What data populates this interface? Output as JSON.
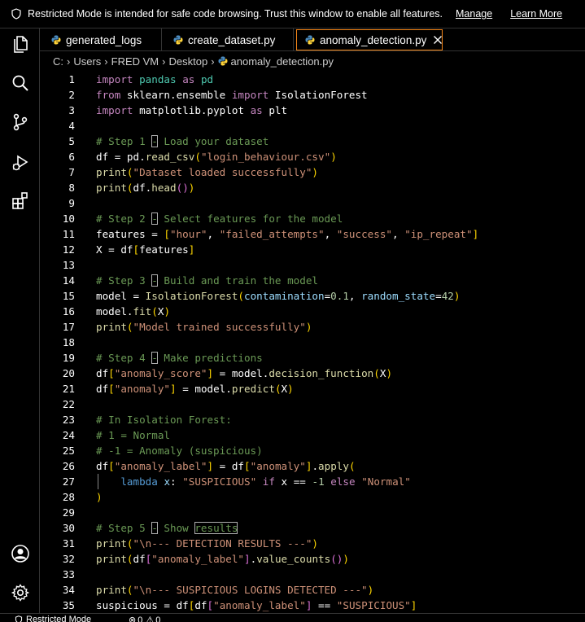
{
  "banner": {
    "message": "Restricted Mode is intended for safe code browsing. Trust this window to enable all features.",
    "manage": "Manage",
    "learn_more": "Learn More"
  },
  "activity_bar": {
    "items": [
      "explorer-icon",
      "search-icon",
      "source-control-icon",
      "run-debug-icon",
      "extensions-icon",
      "accounts-icon",
      "settings-gear-icon"
    ]
  },
  "tabs": [
    {
      "label": "generated_logs"
    },
    {
      "label": "create_dataset.py"
    },
    {
      "label": "anomaly_detection.py",
      "active": true
    }
  ],
  "breadcrumb": [
    "C:",
    "Users",
    "FRED VM",
    "Desktop",
    "anomaly_detection.py"
  ],
  "editor": {
    "lines": [
      {
        "n": "1",
        "tokens": [
          [
            "import",
            "kw"
          ],
          [
            " ",
            ""
          ],
          [
            "pandas",
            "cls"
          ],
          [
            " ",
            ""
          ],
          [
            "as",
            "kw"
          ],
          [
            " ",
            ""
          ],
          [
            "pd",
            "cls"
          ]
        ]
      },
      {
        "n": "2",
        "tokens": [
          [
            "from",
            "kw"
          ],
          [
            " sklearn.ensemble ",
            ""
          ],
          [
            "import",
            "kw"
          ],
          [
            " IsolationForest",
            ""
          ]
        ]
      },
      {
        "n": "3",
        "tokens": [
          [
            "import",
            "kw"
          ],
          [
            " matplotlib.pyplot ",
            ""
          ],
          [
            "as",
            "kw"
          ],
          [
            " plt",
            ""
          ]
        ]
      },
      {
        "n": "4",
        "tokens": []
      },
      {
        "n": "5",
        "tokens": [
          [
            "# Step 1 ",
            "cm"
          ],
          [
            "-",
            "cm hl"
          ],
          [
            " Load your dataset",
            "cm"
          ]
        ]
      },
      {
        "n": "6",
        "tokens": [
          [
            "df",
            ""
          ],
          [
            " = ",
            ""
          ],
          [
            "pd",
            ""
          ],
          [
            ".",
            ""
          ],
          [
            "read_csv",
            "fn"
          ],
          [
            "(",
            "pr1"
          ],
          [
            "\"login_behaviour.csv\"",
            "str"
          ],
          [
            ")",
            "pr1"
          ]
        ]
      },
      {
        "n": "7",
        "tokens": [
          [
            "print",
            "fn"
          ],
          [
            "(",
            "pr1"
          ],
          [
            "\"Dataset loaded successfully\"",
            "str"
          ],
          [
            ")",
            "pr1"
          ]
        ]
      },
      {
        "n": "8",
        "tokens": [
          [
            "print",
            "fn"
          ],
          [
            "(",
            "pr1"
          ],
          [
            "df.",
            ""
          ],
          [
            "head",
            "fn"
          ],
          [
            "()",
            "pr2"
          ],
          [
            ")",
            "pr1"
          ]
        ]
      },
      {
        "n": "9",
        "tokens": []
      },
      {
        "n": "10",
        "tokens": [
          [
            "# Step 2 ",
            "cm"
          ],
          [
            "-",
            "cm hl"
          ],
          [
            " Select features for the model",
            "cm"
          ]
        ]
      },
      {
        "n": "11",
        "tokens": [
          [
            "features",
            ""
          ],
          [
            " = ",
            ""
          ],
          [
            "[",
            "pr1"
          ],
          [
            "\"hour\"",
            "str"
          ],
          [
            ", ",
            ""
          ],
          [
            "\"failed_attempts\"",
            "str"
          ],
          [
            ", ",
            ""
          ],
          [
            "\"success\"",
            "str"
          ],
          [
            ", ",
            ""
          ],
          [
            "\"ip_repeat\"",
            "str"
          ],
          [
            "]",
            "pr1"
          ]
        ]
      },
      {
        "n": "12",
        "tokens": [
          [
            "X",
            ""
          ],
          [
            " = df",
            ""
          ],
          [
            "[",
            "pr1"
          ],
          [
            "features",
            ""
          ],
          [
            "]",
            "pr1"
          ]
        ]
      },
      {
        "n": "13",
        "tokens": []
      },
      {
        "n": "14",
        "tokens": [
          [
            "# Step 3 ",
            "cm"
          ],
          [
            "-",
            "cm hl"
          ],
          [
            " Build and train the model",
            "cm"
          ]
        ]
      },
      {
        "n": "15",
        "tokens": [
          [
            "model",
            ""
          ],
          [
            " = ",
            ""
          ],
          [
            "IsolationForest",
            "fn"
          ],
          [
            "(",
            "pr1"
          ],
          [
            "contamination",
            "var"
          ],
          [
            "=",
            ""
          ],
          [
            "0.1",
            "num"
          ],
          [
            ", ",
            ""
          ],
          [
            "random_state",
            "var"
          ],
          [
            "=",
            ""
          ],
          [
            "42",
            "num"
          ],
          [
            ")",
            "pr1"
          ]
        ]
      },
      {
        "n": "16",
        "tokens": [
          [
            "model.",
            ""
          ],
          [
            "fit",
            "fn"
          ],
          [
            "(",
            "pr1"
          ],
          [
            "X",
            ""
          ],
          [
            ")",
            "pr1"
          ]
        ]
      },
      {
        "n": "17",
        "tokens": [
          [
            "print",
            "fn"
          ],
          [
            "(",
            "pr1"
          ],
          [
            "\"Model trained successfully\"",
            "str"
          ],
          [
            ")",
            "pr1"
          ]
        ]
      },
      {
        "n": "18",
        "tokens": []
      },
      {
        "n": "19",
        "tokens": [
          [
            "# Step 4 ",
            "cm"
          ],
          [
            "-",
            "cm hl"
          ],
          [
            " Make predictions",
            "cm"
          ]
        ]
      },
      {
        "n": "20",
        "tokens": [
          [
            "df",
            ""
          ],
          [
            "[",
            "pr1"
          ],
          [
            "\"anomaly_score\"",
            "str"
          ],
          [
            "]",
            "pr1"
          ],
          [
            " = model.",
            ""
          ],
          [
            "decision_function",
            "fn"
          ],
          [
            "(",
            "pr1"
          ],
          [
            "X",
            ""
          ],
          [
            ")",
            "pr1"
          ]
        ]
      },
      {
        "n": "21",
        "tokens": [
          [
            "df",
            ""
          ],
          [
            "[",
            "pr1"
          ],
          [
            "\"anomaly\"",
            "str"
          ],
          [
            "]",
            "pr1"
          ],
          [
            " = model.",
            ""
          ],
          [
            "predict",
            "fn"
          ],
          [
            "(",
            "pr1"
          ],
          [
            "X",
            ""
          ],
          [
            ")",
            "pr1"
          ]
        ]
      },
      {
        "n": "22",
        "tokens": []
      },
      {
        "n": "23",
        "tokens": [
          [
            "# In Isolation Forest:",
            "cm"
          ]
        ]
      },
      {
        "n": "24",
        "tokens": [
          [
            "# 1 = Normal",
            "cm"
          ]
        ]
      },
      {
        "n": "25",
        "tokens": [
          [
            "# -1 = Anomaly (suspicious)",
            "cm"
          ]
        ]
      },
      {
        "n": "26",
        "tokens": [
          [
            "df",
            ""
          ],
          [
            "[",
            "pr1"
          ],
          [
            "\"anomaly_label\"",
            "str"
          ],
          [
            "]",
            "pr1"
          ],
          [
            " = df",
            ""
          ],
          [
            "[",
            "pr1"
          ],
          [
            "\"anomaly\"",
            "str"
          ],
          [
            "]",
            "pr1"
          ],
          [
            ".",
            ""
          ],
          [
            "apply",
            "fn"
          ],
          [
            "(",
            "pr1"
          ]
        ]
      },
      {
        "n": "27",
        "guide": true,
        "tokens": [
          [
            "    ",
            ""
          ],
          [
            "lambda",
            "kb"
          ],
          [
            " ",
            ""
          ],
          [
            "x",
            "var"
          ],
          [
            ": ",
            ""
          ],
          [
            "\"SUSPICIOUS\"",
            "str"
          ],
          [
            " ",
            ""
          ],
          [
            "if",
            "kw"
          ],
          [
            " x ",
            ""
          ],
          [
            "==",
            ""
          ],
          [
            " ",
            ""
          ],
          [
            "-1",
            "num"
          ],
          [
            " ",
            ""
          ],
          [
            "else",
            "kw"
          ],
          [
            " ",
            ""
          ],
          [
            "\"Normal\"",
            "str"
          ]
        ]
      },
      {
        "n": "28",
        "tokens": [
          [
            ")",
            "pr1"
          ]
        ]
      },
      {
        "n": "29",
        "tokens": []
      },
      {
        "n": "30",
        "tokens": [
          [
            "# Step 5 ",
            "cm"
          ],
          [
            "-",
            "cm hl"
          ],
          [
            " Show ",
            "cm"
          ],
          [
            "results",
            "cm hl"
          ]
        ]
      },
      {
        "n": "31",
        "tokens": [
          [
            "print",
            "fn"
          ],
          [
            "(",
            "pr1"
          ],
          [
            "\"\\n--- DETECTION RESULTS ---\"",
            "str"
          ],
          [
            ")",
            "pr1"
          ]
        ]
      },
      {
        "n": "32",
        "tokens": [
          [
            "print",
            "fn"
          ],
          [
            "(",
            "pr1"
          ],
          [
            "df",
            ""
          ],
          [
            "[",
            "pr2"
          ],
          [
            "\"anomaly_label\"",
            "str"
          ],
          [
            "]",
            "pr2"
          ],
          [
            ".",
            ""
          ],
          [
            "value_counts",
            "fn"
          ],
          [
            "()",
            "pr2"
          ],
          [
            ")",
            "pr1"
          ]
        ]
      },
      {
        "n": "33",
        "tokens": []
      },
      {
        "n": "34",
        "tokens": [
          [
            "print",
            "fn"
          ],
          [
            "(",
            "pr1"
          ],
          [
            "\"\\n--- SUSPICIOUS LOGINS DETECTED ---\"",
            "str"
          ],
          [
            ")",
            "pr1"
          ]
        ]
      },
      {
        "n": "35",
        "tokens": [
          [
            "suspicious",
            ""
          ],
          [
            " = df",
            ""
          ],
          [
            "[",
            "pr1"
          ],
          [
            "df",
            ""
          ],
          [
            "[",
            "pr2"
          ],
          [
            "\"anomaly_label\"",
            "str"
          ],
          [
            "]",
            "pr2"
          ],
          [
            " == ",
            ""
          ],
          [
            "\"SUSPICIOUS\"",
            "str"
          ],
          [
            "]",
            "pr1"
          ]
        ]
      }
    ]
  },
  "status": {
    "mode": "Restricted Mode",
    "errors": "0",
    "warnings": "0"
  },
  "colors": {
    "background": "#000000",
    "border_active": "#f38518",
    "keyword": "#c586c0",
    "string": "#ce9178",
    "comment": "#6a9955",
    "function": "#dcdcaa"
  }
}
